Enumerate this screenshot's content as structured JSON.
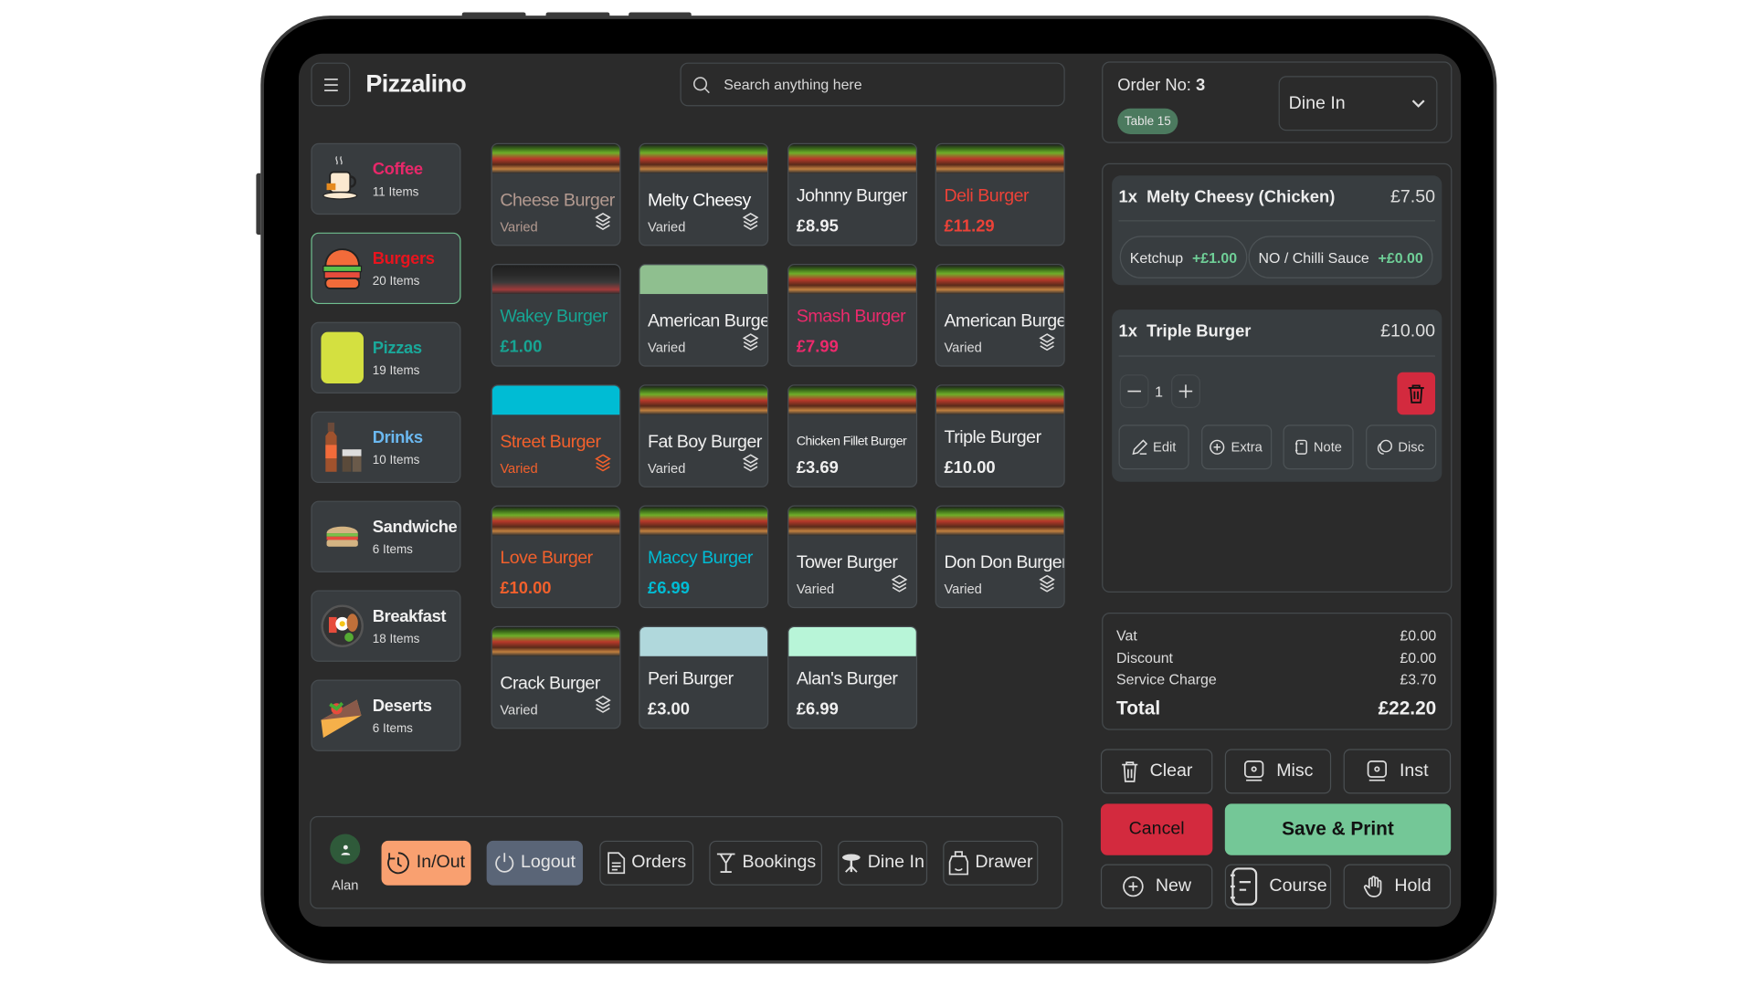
{
  "header": {
    "title": "Pizzalino",
    "search_placeholder": "Search anything here"
  },
  "categories": [
    {
      "name": "Coffee",
      "count": "11 Items",
      "color": "#e8286a",
      "icon": "coffee-cup-icon"
    },
    {
      "name": "Burgers",
      "count": "20 Items",
      "color": "#e8141e",
      "icon": "burger-icon",
      "selected": true
    },
    {
      "name": "Pizzas",
      "count": "19 Items",
      "color": "#1aa89a",
      "icon": "color-swatch",
      "swatch": "#d4e040"
    },
    {
      "name": "Drinks",
      "count": "10 Items",
      "color": "#6bb8f0",
      "icon": "drinks-icon"
    },
    {
      "name": "Sandwiche",
      "count": "6 Items",
      "color": "#f0f0f0",
      "icon": "sandwich-icon"
    },
    {
      "name": "Breakfast",
      "count": "18 Items",
      "color": "#f0f0f0",
      "icon": "breakfast-icon"
    },
    {
      "name": "Deserts",
      "count": "6 Items",
      "color": "#f0f0f0",
      "icon": "cake-icon"
    }
  ],
  "products": [
    {
      "name": "Cheese Burger",
      "sub": "Varied",
      "color": "#b39a90",
      "image": "photo"
    },
    {
      "name": "Melty Cheesy",
      "sub": "Varied",
      "color": "#ffffff",
      "image": "photo"
    },
    {
      "name": "Johnny Burger",
      "price": "£8.95",
      "color": "#f0f0f0",
      "image": "photo"
    },
    {
      "name": "Deli Burger",
      "price": "£11.29",
      "color": "#ec4238",
      "image": "photo"
    },
    {
      "name": "Wakey Burger",
      "price": "£1.00",
      "color": "#17a593",
      "image": "photo-dark"
    },
    {
      "name": "American Burger",
      "sub": "Varied",
      "color": "#f0f0f0",
      "image": "#8fbf8f"
    },
    {
      "name": "Smash Burger",
      "price": "£7.99",
      "color": "#ec2a6c",
      "image": "photo"
    },
    {
      "name": "American Burger",
      "sub": "Varied",
      "color": "#f0f0f0",
      "image": "photo"
    },
    {
      "name": "Street Burger",
      "sub": "Varied",
      "color": "#f2602c",
      "image": "#00bcd4"
    },
    {
      "name": "Fat Boy Burger",
      "sub": "Varied",
      "color": "#f0f0f0",
      "image": "photo"
    },
    {
      "name": "Chicken Fillet Burger",
      "price": "£3.69",
      "color": "#f0f0f0",
      "image": "photo",
      "small": true
    },
    {
      "name": "Triple Burger",
      "price": "£10.00",
      "color": "#f0f0f0",
      "image": "photo"
    },
    {
      "name": "Love Burger",
      "price": "£10.00",
      "color": "#f2602c",
      "image": "photo"
    },
    {
      "name": "Maccy Burger",
      "price": "£6.99",
      "color": "#00bcd4",
      "image": "photo"
    },
    {
      "name": "Tower Burger",
      "sub": "Varied",
      "color": "#f0f0f0",
      "image": "photo"
    },
    {
      "name": "Don Don Burger",
      "sub": "Varied",
      "color": "#f0f0f0",
      "image": "photo"
    },
    {
      "name": "Crack Burger",
      "sub": "Varied",
      "color": "#f0f0f0",
      "image": "photo"
    },
    {
      "name": "Peri Burger",
      "price": "£3.00",
      "color": "#f0f0f0",
      "image": "#b0d8dc"
    },
    {
      "name": "Alan's Burger",
      "price": "£6.99",
      "color": "#f0f0f0",
      "image": "#b8f5d8"
    }
  ],
  "bottom_bar": {
    "user": "Alan",
    "buttons": [
      {
        "label": "In/Out",
        "icon": "clock-icon"
      },
      {
        "label": "Logout",
        "icon": "power-icon"
      },
      {
        "label": "Orders",
        "icon": "document-icon"
      },
      {
        "label": "Bookings",
        "icon": "table-icon"
      },
      {
        "label": "Dine In",
        "icon": "dine-table-icon"
      },
      {
        "label": "Drawer",
        "icon": "drawer-icon"
      }
    ]
  },
  "order": {
    "label": "Order No:",
    "number": "3",
    "table": "Table 15",
    "type": "Dine In",
    "items": [
      {
        "qty": "1x",
        "name": "Melty Cheesy (Chicken)",
        "price": "£7.50",
        "modifiers": [
          {
            "name": "Ketchup",
            "price": "+£1.00"
          },
          {
            "name": "NO / Chilli Sauce",
            "price": "+£0.00"
          }
        ]
      },
      {
        "qty": "1x",
        "name": "Triple Burger",
        "price": "£10.00",
        "quantity": "1",
        "actions": [
          "Edit",
          "Extra",
          "Note",
          "Disc"
        ]
      }
    ],
    "totals": {
      "vat_label": "Vat",
      "vat": "£0.00",
      "discount_label": "Discount",
      "discount": "£0.00",
      "service_label": "Service Charge",
      "service": "£3.70",
      "total_label": "Total",
      "total": "£22.20"
    },
    "buttons": {
      "clear": "Clear",
      "misc": "Misc",
      "inst": "Inst",
      "cancel": "Cancel",
      "save": "Save & Print",
      "new": "New",
      "course": "Course",
      "hold": "Hold"
    }
  },
  "colors": {
    "accent_green": "#6fcf97",
    "cancel": "#d32a3e",
    "save": "#74c797",
    "inout": "#f9a070",
    "logout": "#5a6577"
  }
}
